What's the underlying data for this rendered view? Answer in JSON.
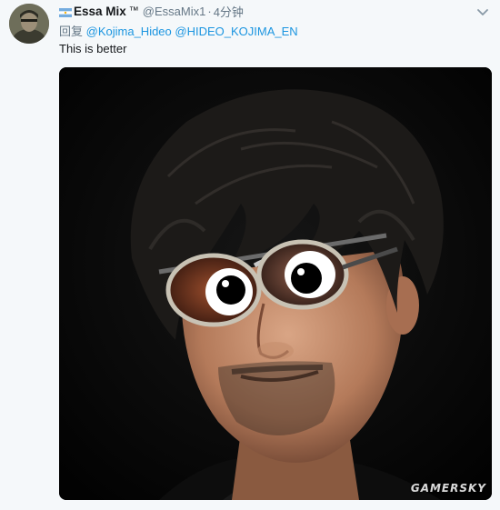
{
  "tweet": {
    "display_name": "Essa Mix",
    "trademark": "™",
    "handle": "@EssaMix1",
    "separator": "·",
    "time": "4分钟",
    "reply_prefix": "回复",
    "mentions": [
      "@Kojima_Hideo",
      "@HIDEO_KOJIMA_EN"
    ],
    "text": "This is better"
  },
  "icons": {
    "flag": "argentina-flag-icon",
    "caret": "chevron-down-icon"
  },
  "watermark": "GAMERSKY",
  "colors": {
    "link": "#1b95e0",
    "secondary_text": "#657786",
    "primary_text": "#14171a",
    "background": "#f5f8fa"
  }
}
